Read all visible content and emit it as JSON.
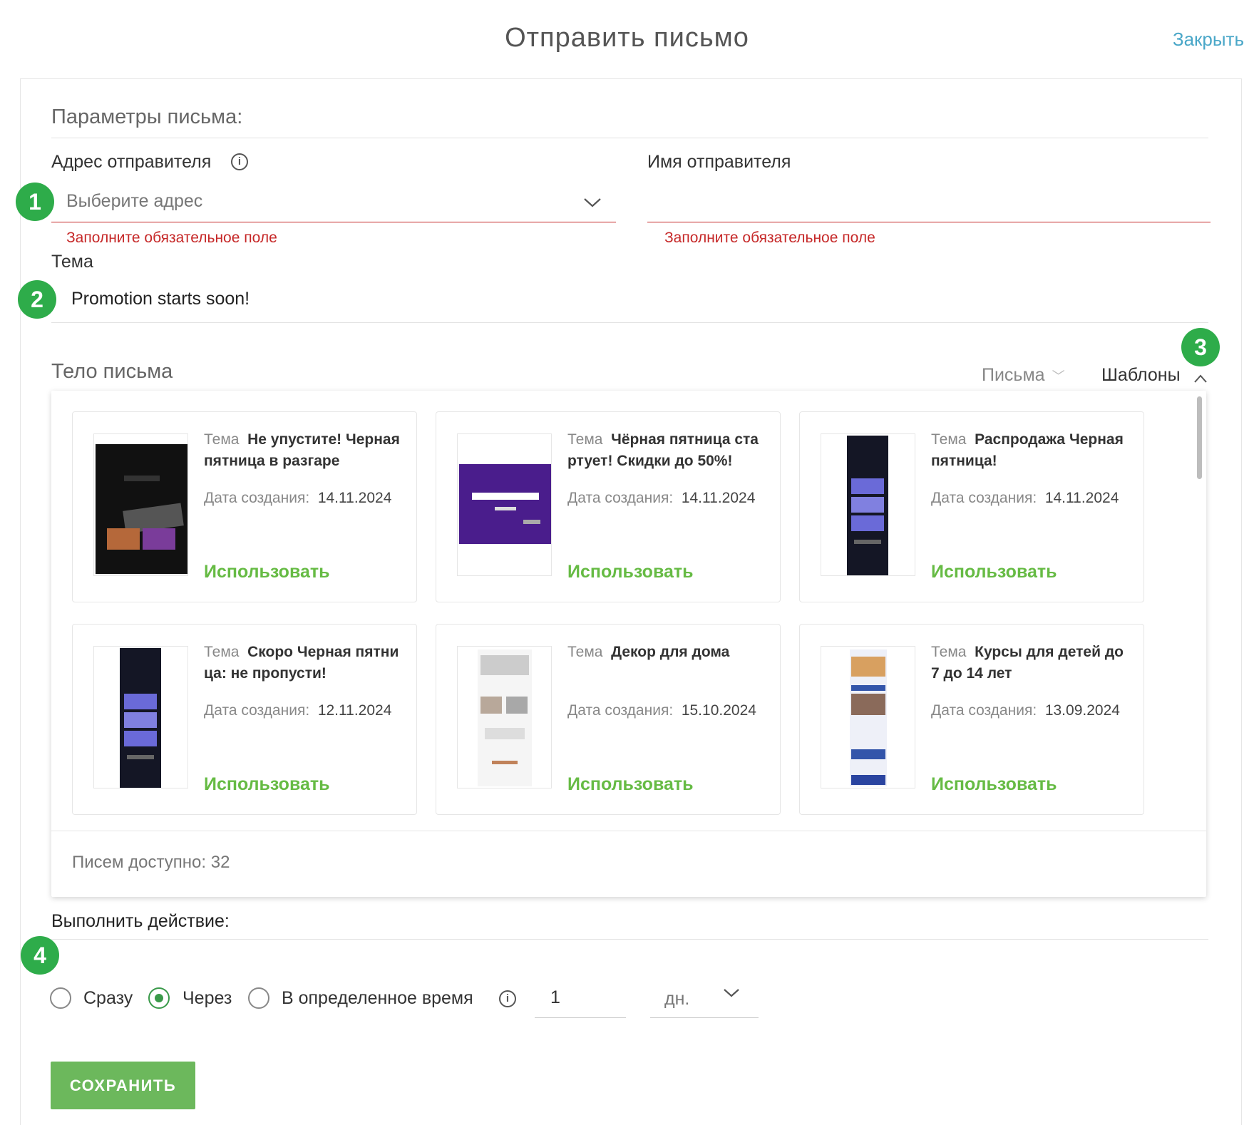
{
  "header": {
    "title": "Отправить письмо",
    "close_label": "Закрыть"
  },
  "params": {
    "section_title": "Параметры письма:",
    "sender_address": {
      "label": "Адрес отправителя",
      "placeholder": "Выберите адрес",
      "error": "Заполните обязательное поле"
    },
    "sender_name": {
      "label": "Имя отправителя",
      "value": "",
      "error": "Заполните обязательное поле"
    },
    "subject": {
      "label": "Тема",
      "value": "Promotion starts soon!"
    }
  },
  "badges": [
    "1",
    "2",
    "3",
    "4"
  ],
  "body": {
    "label": "Тело письма",
    "tabs": [
      {
        "label": "Письма",
        "active": false
      },
      {
        "label": "Шаблоны",
        "active": true
      }
    ],
    "templates": [
      {
        "subject_key": "Тема",
        "subject": "Не упустите! Черная пятница в разгаре",
        "date_key": "Дата создания:",
        "date": "14.11.2024",
        "action": "Использовать"
      },
      {
        "subject_key": "Тема",
        "subject": "Чёрная пятница стартует! Скидки до 50%!",
        "date_key": "Дата создания:",
        "date": "14.11.2024",
        "action": "Использовать"
      },
      {
        "subject_key": "Тема",
        "subject": "Распродажа Черная пятница!",
        "date_key": "Дата создания:",
        "date": "14.11.2024",
        "action": "Использовать"
      },
      {
        "subject_key": "Тема",
        "subject": "Скоро Черная пятница: не пропусти!",
        "date_key": "Дата создания:",
        "date": "12.11.2024",
        "action": "Использовать"
      },
      {
        "subject_key": "Тема",
        "subject": "Декор для дома",
        "date_key": "Дата создания:",
        "date": "15.10.2024",
        "action": "Использовать"
      },
      {
        "subject_key": "Тема",
        "subject": "Курсы для детей до 7 до 14 лет",
        "date_key": "Дата создания:",
        "date": "13.09.2024",
        "action": "Использовать"
      }
    ],
    "available_label": "Писем доступно: 32"
  },
  "action": {
    "title": "Выполнить действие:",
    "options": [
      {
        "label": "Сразу",
        "checked": false
      },
      {
        "label": "Через",
        "checked": true
      },
      {
        "label": "В определенное время",
        "checked": false
      }
    ],
    "delay_value": "1",
    "delay_unit": "дн."
  },
  "save_label": "СОХРАНИТЬ",
  "colors": {
    "accent_green": "#6cb85c",
    "badge_green": "#2eac4a",
    "error_red": "#c62828",
    "link_blue": "#4aa7c8"
  }
}
